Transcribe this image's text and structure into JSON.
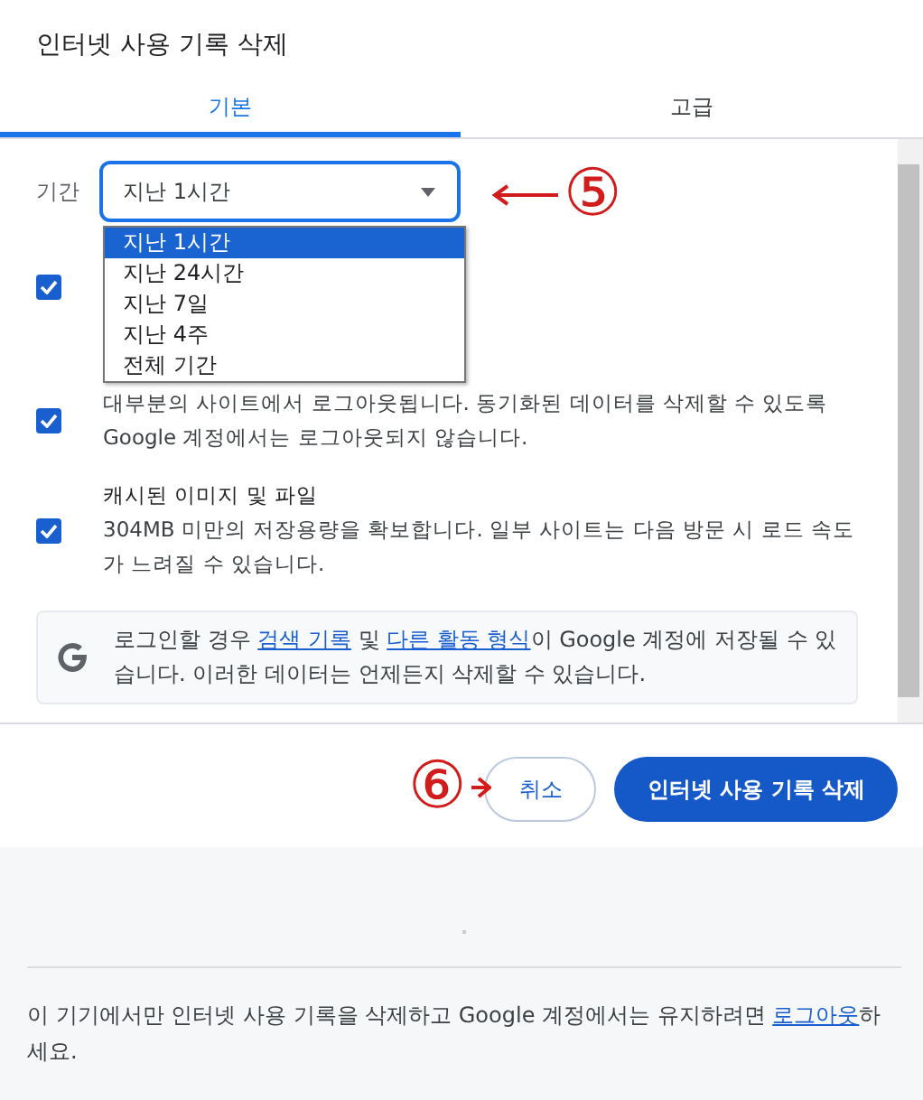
{
  "dialog": {
    "title": "인터넷 사용 기록 삭제"
  },
  "tabs": [
    {
      "label": "기본",
      "selected": true
    },
    {
      "label": "고급",
      "selected": false
    }
  ],
  "time_range": {
    "label": "기간",
    "value": "지난 1시간",
    "options": [
      {
        "label": "지난 1시간",
        "selected": true
      },
      {
        "label": "지난 24시간",
        "selected": false
      },
      {
        "label": "지난 7일",
        "selected": false
      },
      {
        "label": "지난 4주",
        "selected": false
      },
      {
        "label": "전체 기간",
        "selected": false
      }
    ]
  },
  "items": [
    {
      "checked": true
    },
    {
      "checked": true,
      "description": "대부분의 사이트에서 로그아웃됩니다. 동기화된 데이터를 삭제할 수 있도록 Google 계정에서는 로그아웃되지 않습니다."
    },
    {
      "checked": true,
      "title": "캐시된 이미지 및 파일",
      "description": "304MB 미만의 저장용량을 확보합니다. 일부 사이트는 다음 방문 시 로드 속도가 느려질 수 있습니다."
    }
  ],
  "info": [
    {
      "kind": "text",
      "text": "로그인할 경우 "
    },
    {
      "kind": "link",
      "text": "검색 기록"
    },
    {
      "kind": "text",
      "text": " 및 "
    },
    {
      "kind": "link",
      "text": "다른 활동 형식"
    },
    {
      "kind": "text",
      "text": "이 Google 계정에 저장될 수 있습니다. 이러한 데이터는 언제든지 삭제할 수 있습니다."
    }
  ],
  "buttons": [
    {
      "label": "취소",
      "kind": "secondary"
    },
    {
      "label": "인터넷 사용 기록 삭제",
      "kind": "primary"
    }
  ],
  "annotations": [
    {
      "text": "⑤",
      "kind": "arrow-left"
    },
    {
      "text": "⑥",
      "kind": "arrow-right"
    }
  ],
  "footer": [
    {
      "kind": "text",
      "text": "이 기기에서만 인터넷 사용 기록을 삭제하고 Google 계정에서는 유지하려면 "
    },
    {
      "kind": "link",
      "text": "로그아웃"
    },
    {
      "kind": "text",
      "text": "하세요."
    }
  ]
}
